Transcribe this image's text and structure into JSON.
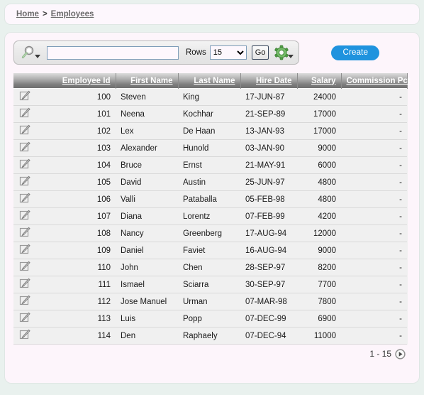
{
  "breadcrumb": {
    "items": [
      {
        "label": "Home"
      },
      {
        "label": "Employees"
      }
    ],
    "separator": ">"
  },
  "toolbar": {
    "search_icon": "magnifier-dropdown-icon",
    "search_value": "",
    "search_placeholder": "",
    "rows_label": "Rows",
    "rows_value": "15",
    "rows_options": [
      "15"
    ],
    "go_label": "Go",
    "actions_icon": "gear-dropdown-icon",
    "create_label": "Create"
  },
  "table": {
    "row_icon": "edit-pencil-icon",
    "columns": [
      {
        "label": "",
        "align": "left"
      },
      {
        "label": "Employee Id",
        "align": "right"
      },
      {
        "label": "First Name",
        "align": "left"
      },
      {
        "label": "Last Name",
        "align": "left"
      },
      {
        "label": "Hire Date",
        "align": "left"
      },
      {
        "label": "Salary",
        "align": "right"
      },
      {
        "label": "Commission Pct",
        "align": "right"
      }
    ],
    "rows": [
      {
        "employee_id": "100",
        "first_name": "Steven",
        "last_name": "King",
        "hire_date": "17-JUN-87",
        "salary": "24000",
        "commission_pct": "-"
      },
      {
        "employee_id": "101",
        "first_name": "Neena",
        "last_name": "Kochhar",
        "hire_date": "21-SEP-89",
        "salary": "17000",
        "commission_pct": "-"
      },
      {
        "employee_id": "102",
        "first_name": "Lex",
        "last_name": "De Haan",
        "hire_date": "13-JAN-93",
        "salary": "17000",
        "commission_pct": "-"
      },
      {
        "employee_id": "103",
        "first_name": "Alexander",
        "last_name": "Hunold",
        "hire_date": "03-JAN-90",
        "salary": "9000",
        "commission_pct": "-"
      },
      {
        "employee_id": "104",
        "first_name": "Bruce",
        "last_name": "Ernst",
        "hire_date": "21-MAY-91",
        "salary": "6000",
        "commission_pct": "-"
      },
      {
        "employee_id": "105",
        "first_name": "David",
        "last_name": "Austin",
        "hire_date": "25-JUN-97",
        "salary": "4800",
        "commission_pct": "-"
      },
      {
        "employee_id": "106",
        "first_name": "Valli",
        "last_name": "Pataballa",
        "hire_date": "05-FEB-98",
        "salary": "4800",
        "commission_pct": "-"
      },
      {
        "employee_id": "107",
        "first_name": "Diana",
        "last_name": "Lorentz",
        "hire_date": "07-FEB-99",
        "salary": "4200",
        "commission_pct": "-"
      },
      {
        "employee_id": "108",
        "first_name": "Nancy",
        "last_name": "Greenberg",
        "hire_date": "17-AUG-94",
        "salary": "12000",
        "commission_pct": "-"
      },
      {
        "employee_id": "109",
        "first_name": "Daniel",
        "last_name": "Faviet",
        "hire_date": "16-AUG-94",
        "salary": "9000",
        "commission_pct": "-"
      },
      {
        "employee_id": "110",
        "first_name": "John",
        "last_name": "Chen",
        "hire_date": "28-SEP-97",
        "salary": "8200",
        "commission_pct": "-"
      },
      {
        "employee_id": "111",
        "first_name": "Ismael",
        "last_name": "Sciarra",
        "hire_date": "30-SEP-97",
        "salary": "7700",
        "commission_pct": "-"
      },
      {
        "employee_id": "112",
        "first_name": "Jose Manuel",
        "last_name": "Urman",
        "hire_date": "07-MAR-98",
        "salary": "7800",
        "commission_pct": "-"
      },
      {
        "employee_id": "113",
        "first_name": "Luis",
        "last_name": "Popp",
        "hire_date": "07-DEC-99",
        "salary": "6900",
        "commission_pct": "-"
      },
      {
        "employee_id": "114",
        "first_name": "Den",
        "last_name": "Raphaely",
        "hire_date": "07-DEC-94",
        "salary": "11000",
        "commission_pct": "-"
      }
    ]
  },
  "pagination": {
    "range_label": "1 - 15",
    "next_icon": "next-page-icon"
  },
  "colors": {
    "page_background": "#e9f1ee",
    "panel_background": "#fdf5fb",
    "panel_border": "#dfe7e4",
    "create_button": "#1f93de",
    "gear_green": "#4e9e43",
    "header_dark": "#6e6e6e",
    "row_background": "#f0f0f0"
  }
}
